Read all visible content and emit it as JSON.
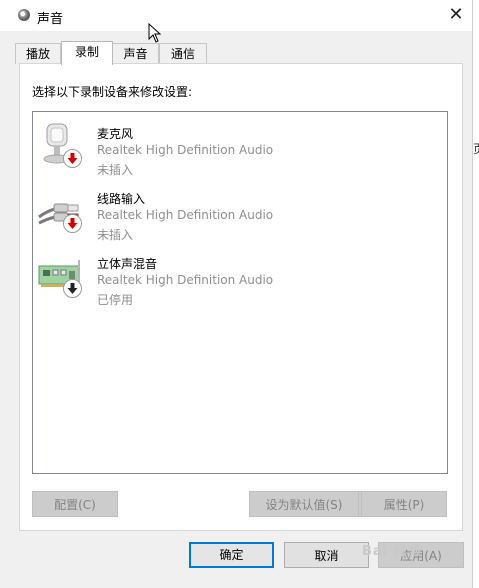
{
  "window": {
    "title": "声音",
    "close_glyph": "✕"
  },
  "tabs": [
    {
      "label": "播放",
      "active": false
    },
    {
      "label": "录制",
      "active": true
    },
    {
      "label": "声音",
      "active": false
    },
    {
      "label": "通信",
      "active": false
    }
  ],
  "panel": {
    "instruction": "选择以下录制设备来修改设置:"
  },
  "devices": [
    {
      "name": "麦克风",
      "driver": "Realtek High Definition Audio",
      "status": "未插入",
      "icon": "microphone-icon",
      "badge": "red-down-arrow"
    },
    {
      "name": "线路输入",
      "driver": "Realtek High Definition Audio",
      "status": "未插入",
      "icon": "line-in-cable-icon",
      "badge": "red-down-arrow"
    },
    {
      "name": "立体声混音",
      "driver": "Realtek High Definition Audio",
      "status": "已停用",
      "icon": "sound-card-icon",
      "badge": "black-down-arrow"
    }
  ],
  "buttons": {
    "configure": "配置(C)",
    "set_default": "设为默认值(S)",
    "properties": "属性(P)",
    "ok": "确定",
    "cancel": "取消",
    "apply": "应用(A)"
  },
  "background": {
    "sliver_text": "页"
  },
  "watermark": "Bai 经验",
  "colors": {
    "accent": "#0078d7",
    "disabled_text": "#838383",
    "secondary_text": "#8f8f8f",
    "status_red": "#d40000"
  }
}
